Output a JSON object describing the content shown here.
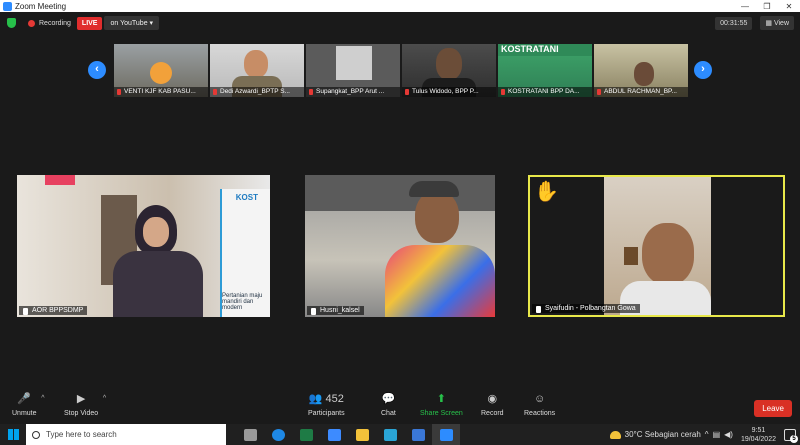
{
  "window": {
    "title": "Zoom Meeting"
  },
  "topbar": {
    "recording_label": "Recording",
    "live_label": "LIVE",
    "stream_label": "on YouTube ▾",
    "timer": "00:31:55",
    "view_label": "View"
  },
  "participants_strip": [
    {
      "name": "VENTI KJF KAB PASU..."
    },
    {
      "name": "Dedi Azwardi_BPTP S..."
    },
    {
      "name": "Supangkat_BPP Arut ..."
    },
    {
      "name": "Tulus Widodo, BPP P..."
    },
    {
      "name": "KOSTRATANI BPP DA..."
    },
    {
      "name": "ABDUL RACHMAN_BP..."
    }
  ],
  "banner_text": "KOSTRATANI",
  "gallery": [
    {
      "name": "AOR BPPSDMP",
      "poster_title": "KOST",
      "poster_text": "Pertanian maju mandiri dan modern"
    },
    {
      "name": "Husni_kalsel"
    },
    {
      "name": "Syaifudin - Polbangtan Gowa"
    }
  ],
  "controls": {
    "unmute": "Unmute",
    "stop_video": "Stop Video",
    "participants": "Participants",
    "participants_count": "452",
    "chat": "Chat",
    "share_screen": "Share Screen",
    "record": "Record",
    "reactions": "Reactions",
    "leave": "Leave"
  },
  "taskbar": {
    "search_placeholder": "Type here to search",
    "weather": "30°C  Sebagian cerah",
    "time": "9:51",
    "date": "19/04/2022",
    "notification_count": "5"
  }
}
